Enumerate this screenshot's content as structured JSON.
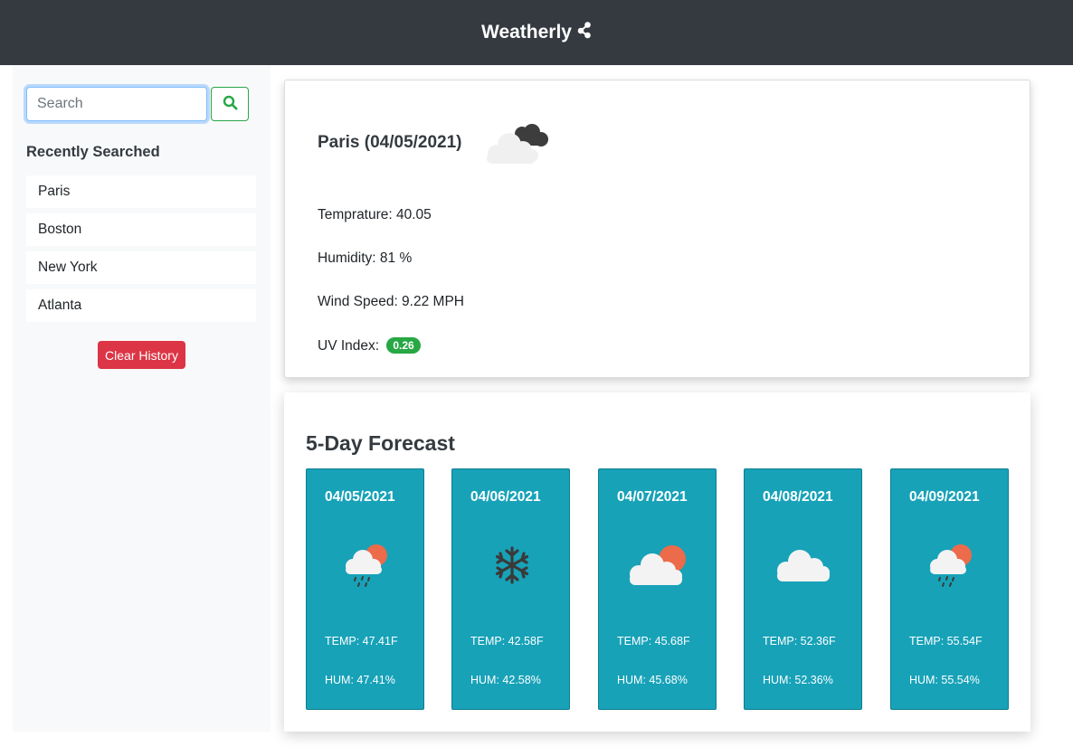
{
  "app": {
    "title": "Weatherly",
    "icon": "share-nodes-icon"
  },
  "search": {
    "placeholder": "Search",
    "value": "",
    "button_icon": "search-icon"
  },
  "history": {
    "title": "Recently Searched",
    "items": [
      "Paris",
      "Boston",
      "New York",
      "Atlanta"
    ],
    "clear_label": "Clear History"
  },
  "current": {
    "title": "Paris (04/05/2021)",
    "icon": "dark-clouds-icon",
    "temperature": "Temprature: 40.05",
    "humidity": "Humidity: 81 %",
    "wind": "Wind Speed: 9.22 MPH",
    "uv_label": "UV Index:",
    "uv_value": "0.26",
    "uv_color": "#28a745"
  },
  "forecast": {
    "title": "5-Day Forecast",
    "days": [
      {
        "date": "04/05/2021",
        "icon": "sun-cloud-rain-icon",
        "temp": "TEMP: 47.41F",
        "hum": "HUM: 47.41%"
      },
      {
        "date": "04/06/2021",
        "icon": "snowflake-icon",
        "temp": "TEMP: 42.58F",
        "hum": "HUM: 42.58%"
      },
      {
        "date": "04/07/2021",
        "icon": "sun-cloud-icon",
        "temp": "TEMP: 45.68F",
        "hum": "HUM: 45.68%"
      },
      {
        "date": "04/08/2021",
        "icon": "cloud-icon",
        "temp": "TEMP: 52.36F",
        "hum": "HUM: 52.36%"
      },
      {
        "date": "04/09/2021",
        "icon": "sun-cloud-rain-icon",
        "temp": "TEMP: 55.54F",
        "hum": "HUM: 55.54%"
      }
    ]
  },
  "colors": {
    "navbar": "#343a40",
    "card_accent": "#17a2b8",
    "danger": "#dc3545",
    "success": "#28a745"
  }
}
